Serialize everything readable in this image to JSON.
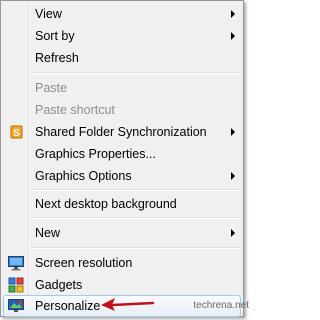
{
  "menu": {
    "view": "View",
    "sort_by": "Sort by",
    "refresh": "Refresh",
    "paste": "Paste",
    "paste_shortcut": "Paste shortcut",
    "shared_folder_sync": "Shared Folder Synchronization",
    "graphics_properties": "Graphics Properties...",
    "graphics_options": "Graphics Options",
    "next_desktop_background": "Next desktop background",
    "new": "New",
    "screen_resolution": "Screen resolution",
    "gadgets": "Gadgets",
    "personalize": "Personalize"
  },
  "watermark": "techrena.net",
  "colors": {
    "menu_background": "#f0f0f0",
    "hover_border": "#a8c8e8",
    "disabled_text": "#8d8d8d",
    "annotation_arrow": "#c0141b"
  },
  "icons": {
    "shared_folder_sync": "sync-icon",
    "screen_resolution": "monitor-icon",
    "gadgets": "gadgets-icon",
    "personalize": "personalize-icon"
  }
}
